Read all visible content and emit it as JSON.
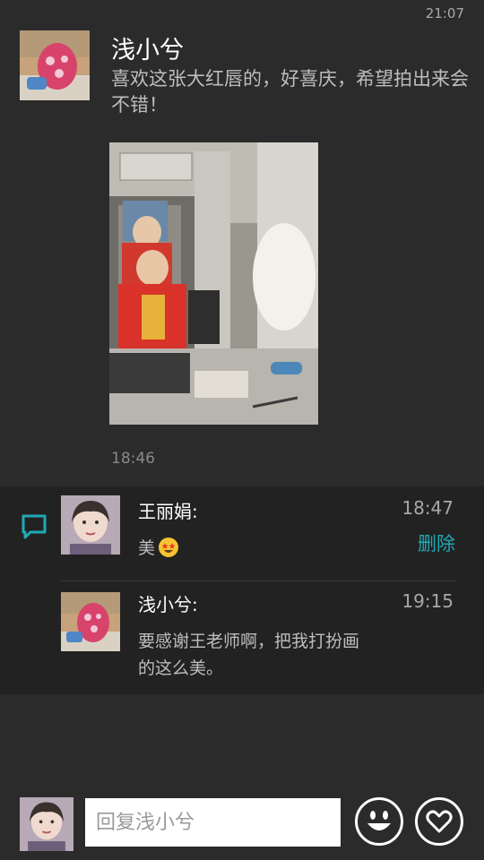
{
  "status_bar": {
    "time": "21:07"
  },
  "post": {
    "author": "浅小兮",
    "text": "喜欢这张大红唇的，好喜庆，希望拍出来会不错！",
    "time": "18:46"
  },
  "comments": [
    {
      "author": "王丽娟:",
      "time": "18:47",
      "text": "美",
      "emoji": "star-struck-emoji",
      "delete_label": "删除"
    },
    {
      "author": "浅小兮:",
      "time": "19:15",
      "text": "要感谢王老师啊，把我打扮画的这么美。"
    }
  ],
  "reply": {
    "placeholder": "回复浅小兮"
  },
  "icons": {
    "comment": "comment-bubble-icon",
    "emoji": "smiley-icon",
    "like": "heart-icon"
  },
  "colors": {
    "accent": "#1fa9b4",
    "background": "#2b2b2b",
    "panel": "#222222"
  }
}
